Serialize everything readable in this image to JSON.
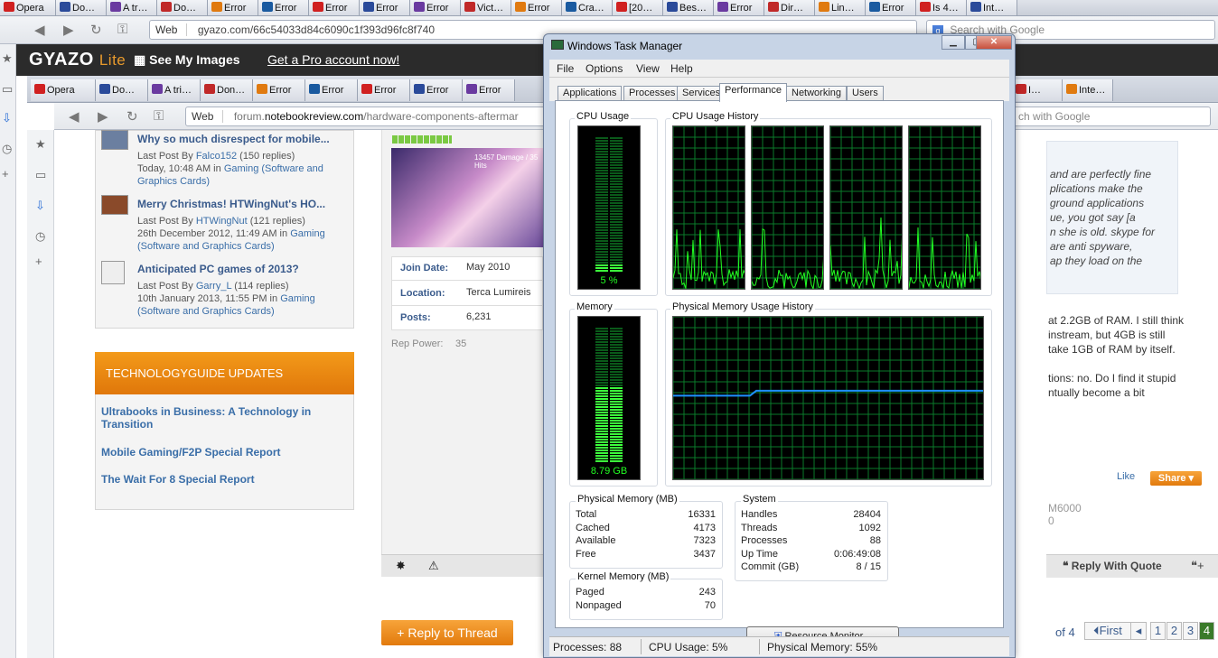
{
  "outer_tabs": [
    "Opera",
    "Do…",
    "A tr…",
    "Do…",
    "Error",
    "Error",
    "Error",
    "Error",
    "Error",
    "Vict…",
    "Error",
    "Cra…",
    "[20…",
    "Bes…",
    "Error",
    "Dir…",
    "Lin…",
    "Error",
    "Is 4…",
    "Int…"
  ],
  "outer_address": {
    "web_label": "Web",
    "url": "gyazo.com/66c54033d84c6090c1f393d96fc8f740",
    "search_placeholder": "Search with Google"
  },
  "gyazo": {
    "logo": "GYAZO",
    "logo_suffix": "Lite",
    "see_images": "See My Images",
    "pro_link": "Get a Pro account now!"
  },
  "inner_tabs": [
    "Opera",
    "Do…",
    "A tri…",
    "Don…",
    "Error",
    "Error",
    "Error",
    "Error",
    "Error",
    "I…",
    "Inte…"
  ],
  "inner_address": {
    "web_label": "Web",
    "url_prefix": "forum.",
    "url_domain": "notebookreview.com",
    "url_rest": "/hardware-components-aftermar",
    "search_partial": "ch with Google"
  },
  "forum": {
    "threads": [
      {
        "title": "Why so much disrespect for mobile...",
        "lastpost_label": "Last Post By",
        "user": "Falco152",
        "replies": "(150 replies)",
        "date": "Today, 10:48 AM in",
        "forum": "Gaming (Software and",
        "forum2": "Graphics Cards)"
      },
      {
        "title": "Merry Christmas! HTWingNut's HO...",
        "lastpost_label": "Last Post By",
        "user": "HTWingNut",
        "replies": "(121 replies)",
        "date": "26th December 2012, 11:49 AM in",
        "forum": "Gaming",
        "forum2": "(Software and Graphics Cards)"
      },
      {
        "title": "Anticipated PC games of 2013?",
        "lastpost_label": "Last Post By",
        "user": "Garry_L",
        "replies": "(114 replies)",
        "date": "10th January 2013, 11:55 PM in",
        "forum": "Gaming",
        "forum2": "(Software and Graphics Cards)"
      }
    ],
    "tg_header": "TECHNOLOGYGUIDE UPDATES",
    "tg_links": [
      "Ultrabooks in Business: A Technology in Transition",
      "Mobile Gaming/F2P Special Report",
      "The Wait For 8 Special Report"
    ],
    "profile": {
      "avatar_caption": "13457 Damage / 35 Hits",
      "join_label": "Join Date:",
      "join_value": "May 2010",
      "location_label": "Location:",
      "location_value": "Terca Lumireis",
      "posts_label": "Posts:",
      "posts_value": "6,231",
      "rep_label": "Rep Power:",
      "rep_value": "35"
    },
    "reply_thread": "+ Reply to Thread",
    "post_text_italic": [
      "and are perfectly fine",
      "plications make the",
      "ground applications",
      "ue, you got say [a",
      "n she is old. skype for",
      "are anti spyware,",
      "ap they load on the"
    ],
    "post_text": [
      "at 2.2GB of RAM. I still think",
      "instream, but 4GB is still",
      "take 1GB of RAM by itself."
    ],
    "post_text2": [
      "tions: no. Do I find it stupid",
      "ntually become a bit"
    ],
    "like": "Like",
    "share": "Share",
    "sig1": "M6000",
    "sig2": "0",
    "reply_quote": "Reply With Quote",
    "pager": {
      "of": "of 4",
      "first": "First",
      "pages": [
        "1",
        "2",
        "3",
        "4"
      ]
    }
  },
  "taskmgr": {
    "title": "Windows Task Manager",
    "menus": [
      "File",
      "Options",
      "View",
      "Help"
    ],
    "tabs": [
      "Applications",
      "Processes",
      "Services",
      "Performance",
      "Networking",
      "Users"
    ],
    "active_tab": "Performance",
    "cpu_usage_label": "CPU Usage",
    "cpu_usage_value": "5 %",
    "cpu_usage_level": 0.05,
    "cpu_history_label": "CPU Usage History",
    "memory_label": "Memory",
    "memory_value": "8.79 GB",
    "memory_level": 0.55,
    "mem_history_label": "Physical Memory Usage History",
    "physical_memory": {
      "title": "Physical Memory (MB)",
      "rows": [
        [
          "Total",
          "16331"
        ],
        [
          "Cached",
          "4173"
        ],
        [
          "Available",
          "7323"
        ],
        [
          "Free",
          "3437"
        ]
      ]
    },
    "system": {
      "title": "System",
      "rows": [
        [
          "Handles",
          "28404"
        ],
        [
          "Threads",
          "1092"
        ],
        [
          "Processes",
          "88"
        ],
        [
          "Up Time",
          "0:06:49:08"
        ],
        [
          "Commit (GB)",
          "8 / 15"
        ]
      ]
    },
    "kernel_memory": {
      "title": "Kernel Memory (MB)",
      "rows": [
        [
          "Paged",
          "243"
        ],
        [
          "Nonpaged",
          "70"
        ]
      ]
    },
    "resource_monitor": "Resource Monitor...",
    "status": {
      "processes": "Processes: 88",
      "cpu": "CPU Usage: 5%",
      "memory": "Physical Memory: 55%"
    },
    "colors": {
      "graph_grid": "#0a7a2a",
      "cpu_line": "#22ff22",
      "mem_line": "#1e8fff"
    }
  }
}
